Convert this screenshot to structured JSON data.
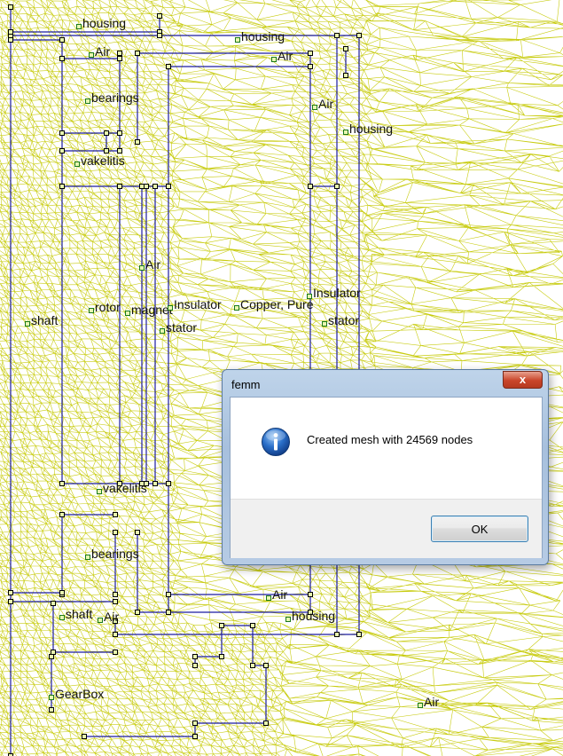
{
  "region_labels": [
    {
      "id": "housing-1",
      "text": "housing"
    },
    {
      "id": "housing-2",
      "text": "housing"
    },
    {
      "id": "air-1",
      "text": "Air"
    },
    {
      "id": "air-2",
      "text": "Air"
    },
    {
      "id": "air-3",
      "text": "Air"
    },
    {
      "id": "housing-3",
      "text": "housing"
    },
    {
      "id": "bearings-1",
      "text": "bearings"
    },
    {
      "id": "vakelitis-1",
      "text": "vakelitis"
    },
    {
      "id": "air-4",
      "text": "Air"
    },
    {
      "id": "insulator-1",
      "text": "Insulator"
    },
    {
      "id": "shaft-1",
      "text": "shaft"
    },
    {
      "id": "rotor",
      "text": "rotor"
    },
    {
      "id": "magnet",
      "text": "magnet"
    },
    {
      "id": "insulator-2",
      "text": "Insulator"
    },
    {
      "id": "copper",
      "text": "Copper, Pure"
    },
    {
      "id": "stator-1",
      "text": "stator"
    },
    {
      "id": "stator-2",
      "text": "stator"
    },
    {
      "id": "vakelitis-2",
      "text": "vakelitis"
    },
    {
      "id": "bearings-2",
      "text": "bearings"
    },
    {
      "id": "air-5",
      "text": "Air"
    },
    {
      "id": "shaft-2",
      "text": "shaft"
    },
    {
      "id": "air-6",
      "text": "Air"
    },
    {
      "id": "housing-4",
      "text": "housing"
    },
    {
      "id": "gearbox",
      "text": "GearBox"
    },
    {
      "id": "air-7",
      "text": "Air"
    }
  ],
  "colors": {
    "mesh": "#c8cc10",
    "outline": "#1a1aa0",
    "node": "#000000"
  },
  "dialog": {
    "title": "femm",
    "close_glyph": "x",
    "icon": "info-icon",
    "message": "Created mesh with 24569 nodes",
    "ok_label": "OK"
  }
}
